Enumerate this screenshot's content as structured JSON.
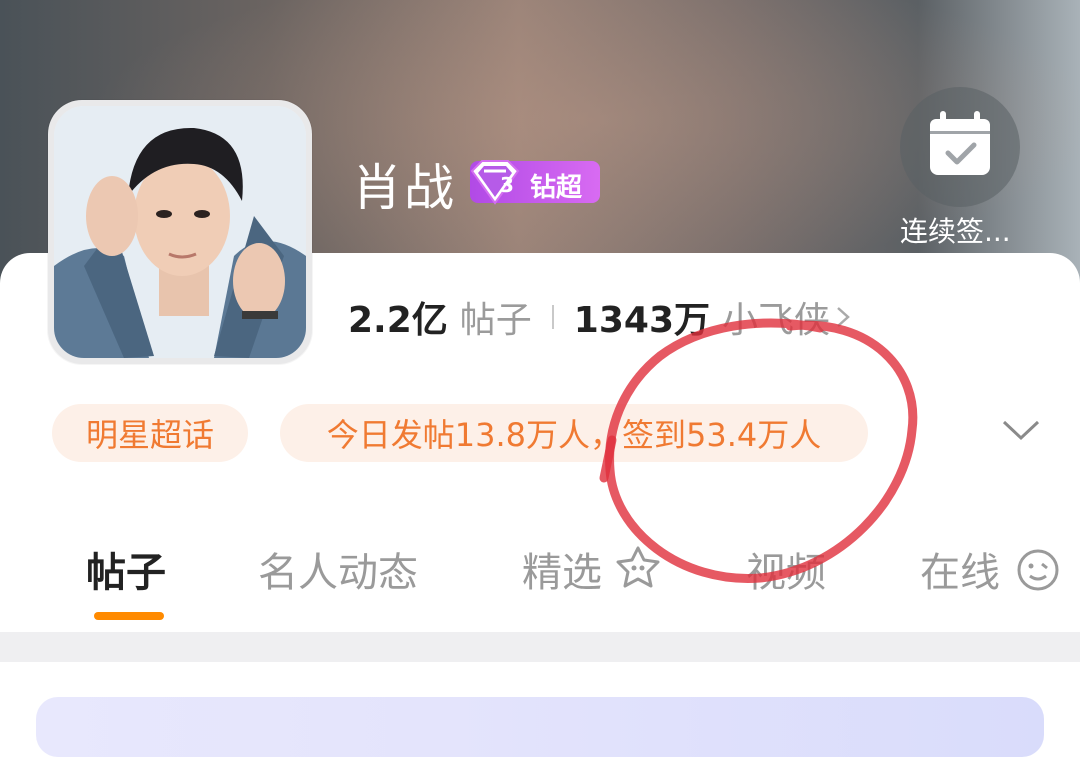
{
  "header": {
    "title": "肖战",
    "badge_level": "3",
    "badge_label": "钻超",
    "checkin_label": "连续签..."
  },
  "stats": {
    "posts_value": "2.2亿",
    "posts_label": "帖子",
    "fans_value": "1343万",
    "fans_label": "小飞侠"
  },
  "pills": {
    "category": "明星超话",
    "today_info": "今日发帖13.8万人，签到53.4万人"
  },
  "tabs": [
    {
      "label": "帖子",
      "active": true
    },
    {
      "label": "名人动态",
      "active": false
    },
    {
      "label": "精选",
      "active": false
    },
    {
      "label": "视频",
      "active": false
    },
    {
      "label": "在线",
      "active": false
    }
  ],
  "colors": {
    "accent": "#ff8a00",
    "pill_text": "#f07a32",
    "pill_bg": "#fdf0e8",
    "badge": "#c15aeb",
    "annotation": "#e0303c"
  },
  "icons": [
    "calendar-check-icon",
    "diamond-badge-icon",
    "chevron-right-icon",
    "chevron-down-icon",
    "sparkle-icon",
    "smiley-icon"
  ]
}
